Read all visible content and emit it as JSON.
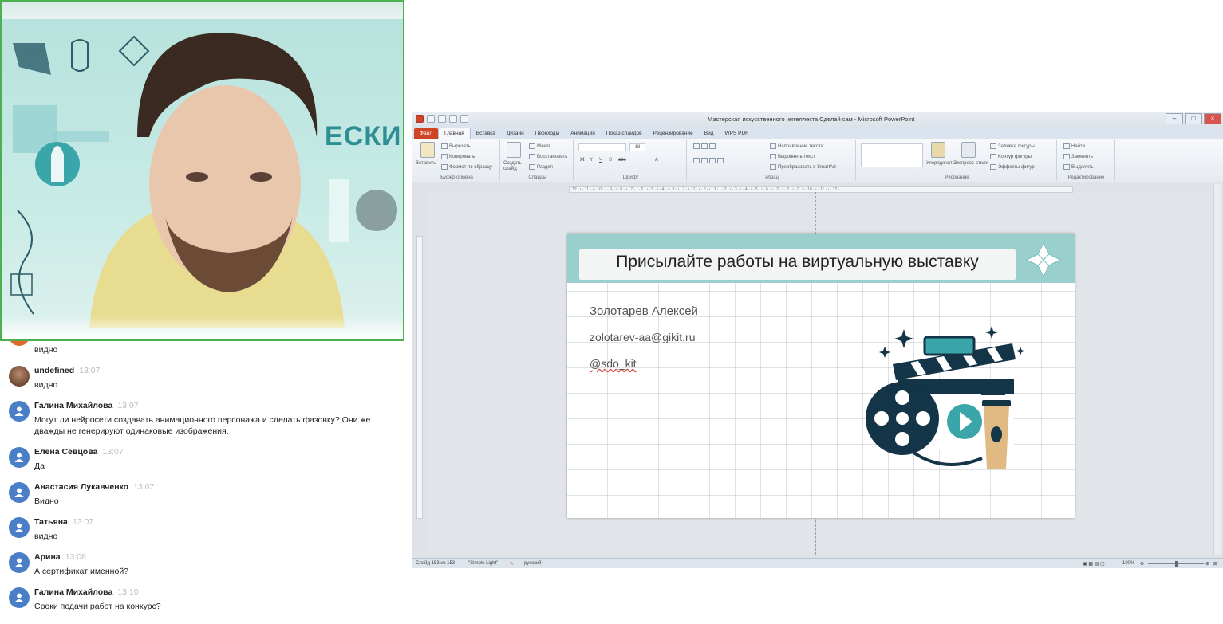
{
  "video": {
    "poster_text": "ЕСКИЕ"
  },
  "chat": {
    "messages": [
      {
        "name": "",
        "time": "",
        "text": "видно",
        "avatar": "partial"
      },
      {
        "name": "undefined",
        "time": "13:07",
        "text": "видно",
        "avatar": "photo"
      },
      {
        "name": "Галина Михайлова",
        "time": "13:07",
        "text": "Могут ли нейросети создавать анимационного персонажа и сделать фазовку? Они же дважды не генерируют одинаковые изображения.",
        "avatar": "user-icon"
      },
      {
        "name": "Елена Севцова",
        "time": "13:07",
        "text": "Да",
        "avatar": "user-icon"
      },
      {
        "name": "Анастасия Лукавченко",
        "time": "13:07",
        "text": "Видно",
        "avatar": "user-icon"
      },
      {
        "name": "Татьяна",
        "time": "13:07",
        "text": "видно",
        "avatar": "user-icon"
      },
      {
        "name": "Арина",
        "time": "13:08",
        "text": "А сертификат именной?",
        "avatar": "user-icon"
      },
      {
        "name": "Галина Михайлова",
        "time": "13:10",
        "text": "Сроки подачи работ на конкурс?",
        "avatar": "user-icon"
      }
    ]
  },
  "ppt": {
    "window_title": "Мастерская искусственного интеллекта Сделай сам - Microsoft PowerPoint",
    "tabs": [
      "Файл",
      "Главная",
      "Вставка",
      "Дизайн",
      "Переходы",
      "Анимация",
      "Показ слайдов",
      "Рецензирование",
      "Вид",
      "WPS PDF"
    ],
    "ribbon": {
      "clipboard": {
        "paste": "Вставить",
        "cut": "Вырезать",
        "copy": "Копировать",
        "format_painter": "Формат по образцу",
        "label": "Буфер обмена"
      },
      "slides": {
        "new_slide": "Создать слайд",
        "layout": "Макет",
        "reset": "Восстановить",
        "section": "Раздел",
        "label": "Слайды"
      },
      "font": {
        "label": "Шрифт",
        "size": "18"
      },
      "paragraph": {
        "text_direction": "Направление текста",
        "align_text": "Выровнять текст",
        "smartart": "Преобразовать в SmartArt",
        "label": "Абзац"
      },
      "drawing": {
        "arrange": "Упорядочить",
        "quick_styles": "Экспресс-стили",
        "fill": "Заливка фигуры",
        "outline": "Контур фигуры",
        "effects": "Эффекты фигур",
        "label": "Рисование"
      },
      "editing": {
        "find": "Найти",
        "replace": "Заменить",
        "select": "Выделить",
        "label": "Редактирование"
      }
    },
    "ruler_text": "· 12 · ı · 11 · ı · 10 · ı · 9 · ı · 8 · ı · 7 · ı · 6 · ı · 5 · ı · 4 · ı · 3 · ı · 2 · ı · 1 · ı · 0 · ı · 1 · ı · 2 · ı · 3 · ı · 4 · ı · 5 · ı · 6 · ı · 7 · ı · 8 · ı · 9 · ı · 10 · ı · 11 · ı · 12 ·",
    "status": {
      "slide_info": "Слайд 153 из 153",
      "theme": "\"Simple Light\"",
      "language": "русский",
      "zoom": "100%"
    },
    "slide": {
      "title": "Присылайте работы на виртуальную выставку",
      "author": "Золотарев Алексей",
      "email": "zolotarev-aa@gikit.ru",
      "handle": "@sdo_kit"
    }
  },
  "colors": {
    "slide_band": "#99d0cd",
    "video_border": "#4caf50",
    "avatar_blue": "#4a7fc7",
    "file_tab": "#d04423"
  }
}
